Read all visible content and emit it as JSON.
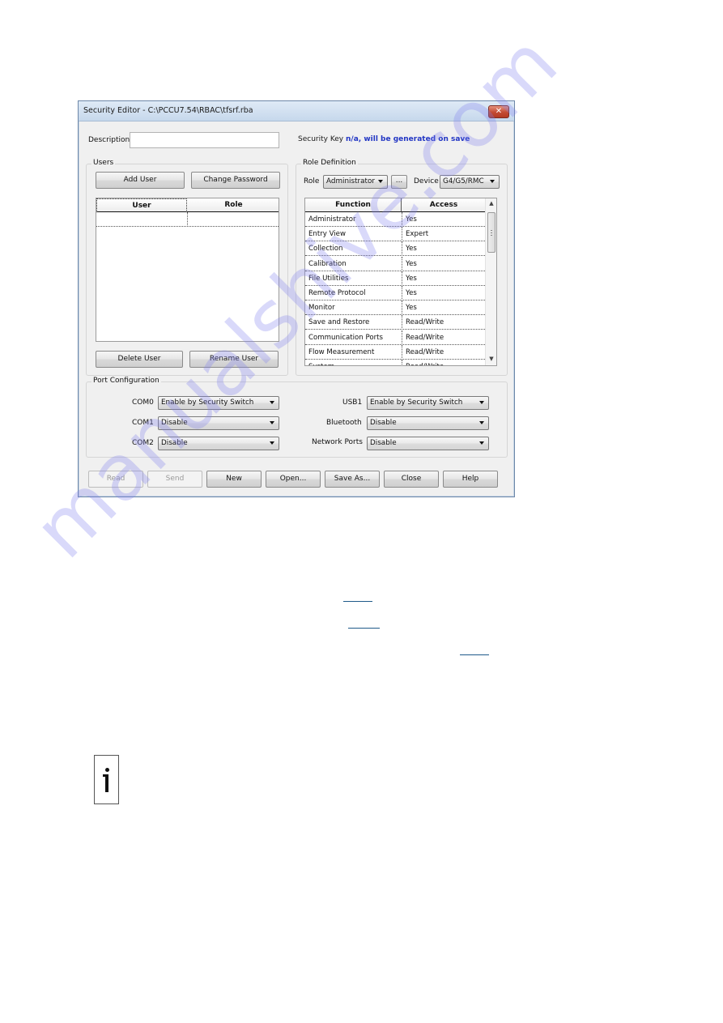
{
  "window": {
    "title": "Security Editor - C:\\PCCU7.54\\RBAC\\tfsrf.rba",
    "close_glyph": "✕"
  },
  "description": {
    "label": "Description",
    "value": "",
    "placeholder": ""
  },
  "security_key": {
    "label": "Security Key",
    "value": "n/a, will be generated on save",
    "value_color": "#2236c4"
  },
  "users": {
    "group_title": "Users",
    "add_user": "Add User",
    "change_password": "Change Password",
    "columns": [
      "User",
      "Role"
    ],
    "rows": [],
    "delete_user": "Delete User",
    "rename_user": "Rename User"
  },
  "role_definition": {
    "group_title": "Role Definition",
    "role_label": "Role",
    "role_value": "Administrator",
    "ellipsis_button": "...",
    "device_label": "Device",
    "device_value": "G4/G5/RMC",
    "columns": [
      "Function",
      "Access"
    ],
    "rows": [
      {
        "function": "Administrator",
        "access": "Yes"
      },
      {
        "function": "Entry View",
        "access": "Expert"
      },
      {
        "function": "Collection",
        "access": "Yes"
      },
      {
        "function": "Calibration",
        "access": "Yes"
      },
      {
        "function": "File Utilities",
        "access": "Yes"
      },
      {
        "function": "Remote Protocol",
        "access": "Yes"
      },
      {
        "function": "Monitor",
        "access": "Yes"
      },
      {
        "function": "Save and Restore",
        "access": "Read/Write"
      },
      {
        "function": "Communication Ports",
        "access": "Read/Write"
      },
      {
        "function": "Flow Measurement",
        "access": "Read/Write"
      },
      {
        "function": "System",
        "access": "Read/Write"
      }
    ],
    "scroll_up_glyph": "▲",
    "scroll_down_glyph": "▼"
  },
  "port_configuration": {
    "group_title": "Port Configuration",
    "ports": [
      {
        "label": "COM0",
        "value": "Enable by Security Switch"
      },
      {
        "label": "COM1",
        "value": "Disable"
      },
      {
        "label": "COM2",
        "value": "Disable"
      },
      {
        "label": "USB1",
        "value": "Enable by Security Switch"
      },
      {
        "label": "Bluetooth",
        "value": "Disable"
      },
      {
        "label": "Network Ports",
        "value": "Disable"
      }
    ]
  },
  "footer_buttons": {
    "read": "Read",
    "send": "Send",
    "new": "New",
    "open": "Open...",
    "save_as": "Save As...",
    "close": "Close",
    "help": "Help"
  },
  "document": {
    "info_icon": "info-icon",
    "link_color": "#1f5a8a",
    "watermark": "manualshive.com"
  }
}
